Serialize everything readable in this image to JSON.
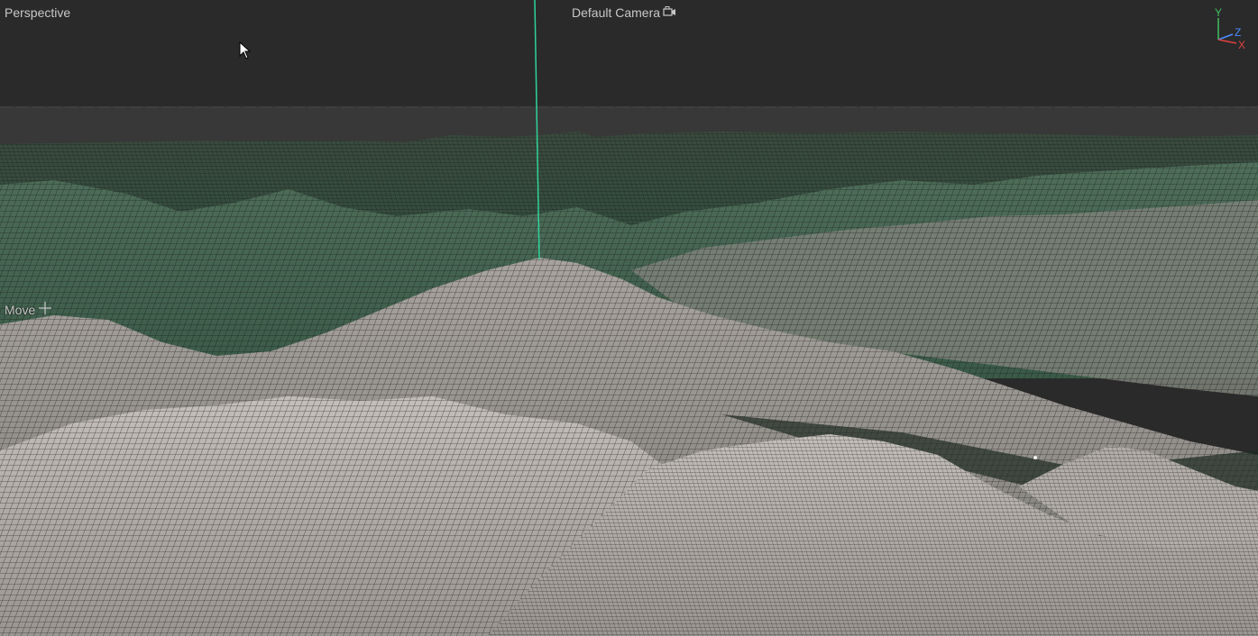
{
  "viewport": {
    "view_mode": "Perspective",
    "camera": {
      "label": "Default Camera",
      "icon": "camera-icon"
    },
    "tool": {
      "label": "Move",
      "icon": "move-crosshair-icon"
    },
    "axis_gizmo": {
      "y_label": "Y",
      "z_label": "Z",
      "x_label": "X",
      "colors": {
        "x": "#e04040",
        "y": "#40c060",
        "z": "#4a8cff"
      }
    },
    "scene": {
      "object": "terrain-wireframe-mesh",
      "colors": {
        "sky": "#2a2a2a",
        "horizon_band": "#393939",
        "terrain_light": "#b8b3ae",
        "terrain_mid": "#6f746c",
        "terrain_dark_green": "#3c5a48",
        "wire": "#141414",
        "selection_line": "#2fd39a"
      }
    }
  }
}
